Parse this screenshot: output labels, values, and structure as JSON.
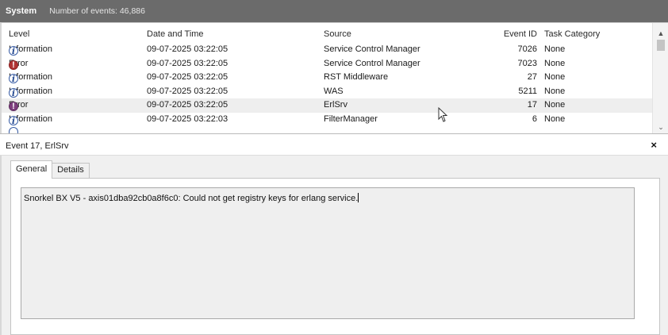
{
  "header": {
    "log_name": "System",
    "event_count": "Number of events: 46,886"
  },
  "columns": {
    "level": "Level",
    "date": "Date and Time",
    "source": "Source",
    "event_id": "Event ID",
    "task_category": "Task Category"
  },
  "events": [
    {
      "level": "Information",
      "icon": "information-icon",
      "date": "09-07-2025 03:22:05",
      "source": "Service Control Manager",
      "event_id": "7026",
      "task": "None"
    },
    {
      "level": "Error",
      "icon": "error-icon",
      "date": "09-07-2025 03:22:05",
      "source": "Service Control Manager",
      "event_id": "7023",
      "task": "None"
    },
    {
      "level": "Information",
      "icon": "information-icon",
      "date": "09-07-2025 03:22:05",
      "source": "RST Middleware",
      "event_id": "27",
      "task": "None"
    },
    {
      "level": "Information",
      "icon": "information-icon",
      "date": "09-07-2025 03:22:05",
      "source": "WAS",
      "event_id": "5211",
      "task": "None"
    },
    {
      "level": "Error",
      "icon": "error-icon",
      "date": "09-07-2025 03:22:05",
      "source": "ErlSrv",
      "event_id": "17",
      "task": "None",
      "selected": true
    },
    {
      "level": "Information",
      "icon": "information-icon",
      "date": "09-07-2025 03:22:03",
      "source": "FilterManager",
      "event_id": "6",
      "task": "None"
    }
  ],
  "detail": {
    "title": "Event 17, ErlSrv",
    "close_label": "×",
    "tabs": [
      "General",
      "Details"
    ],
    "active_tab": "General",
    "description": "Snorkel BX V5 - axis01dba92cb0a8f6c0: Could not get registry keys for erlang service."
  },
  "colors": {
    "titlebar": "#6b6b6b",
    "error_red": "#b03535",
    "info_blue": "#2b4f95",
    "selected_row": "#eeeeee"
  }
}
